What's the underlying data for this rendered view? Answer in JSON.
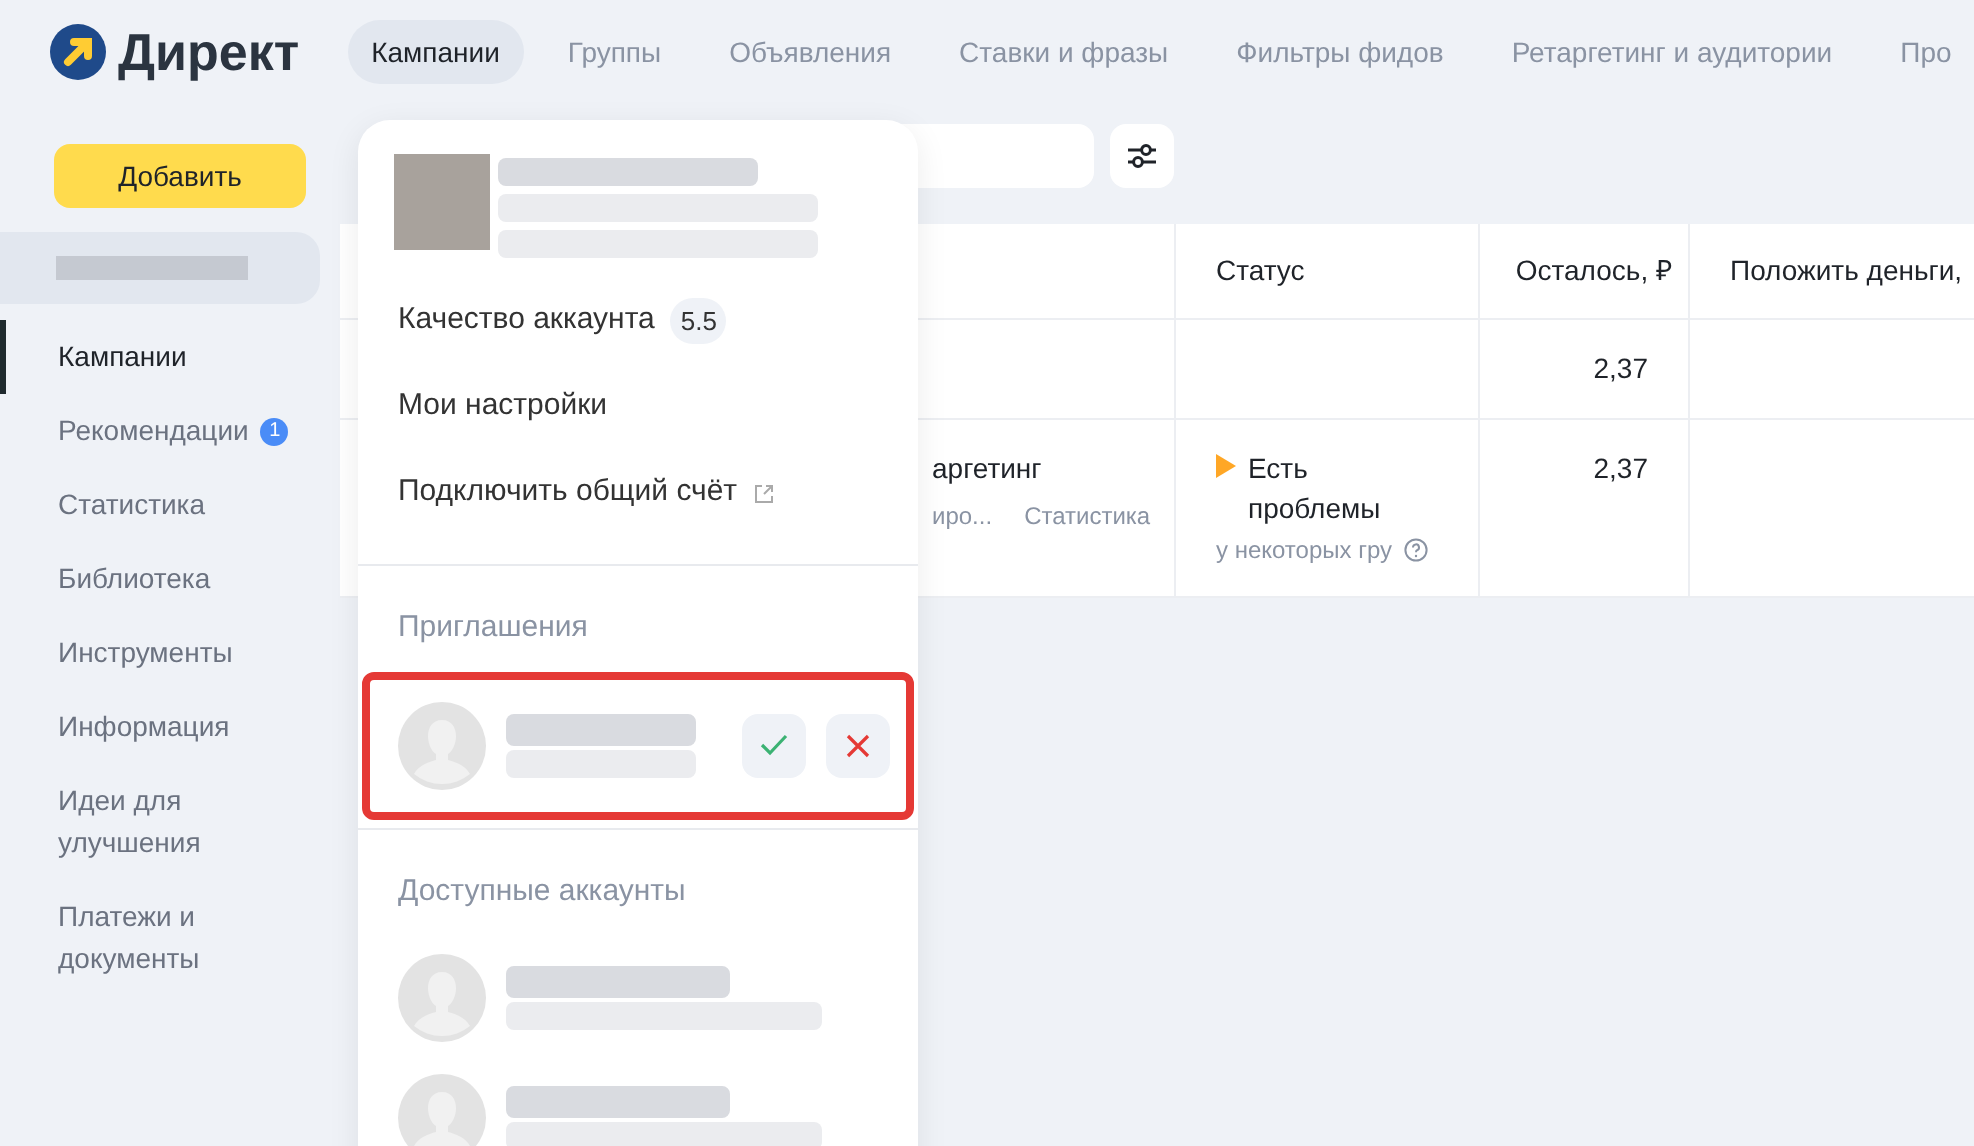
{
  "logo": {
    "text": "Директ"
  },
  "nav_tabs": [
    {
      "label": "Кампании",
      "selected": true
    },
    {
      "label": "Группы",
      "selected": false
    },
    {
      "label": "Объявления",
      "selected": false
    },
    {
      "label": "Ставки и фразы",
      "selected": false
    },
    {
      "label": "Фильтры фидов",
      "selected": false
    },
    {
      "label": "Ретаргетинг и аудитории",
      "selected": false
    },
    {
      "label": "Про",
      "selected": false
    }
  ],
  "sidebar": {
    "add_button": "Добавить",
    "items": [
      {
        "label": "Кампании",
        "selected": true
      },
      {
        "label": "Рекомендации",
        "selected": false,
        "badge": "1"
      },
      {
        "label": "Статистика",
        "selected": false
      },
      {
        "label": "Библиотека",
        "selected": false
      },
      {
        "label": "Инструменты",
        "selected": false
      },
      {
        "label": "Информация",
        "selected": false
      },
      {
        "label": "Идеи для улучшения",
        "selected": false
      },
      {
        "label": "Платежи и документы",
        "selected": false
      }
    ]
  },
  "table": {
    "columns": [
      "Статус",
      "Осталось, ₽",
      "Положить деньги,"
    ],
    "rows": [
      {
        "name": "",
        "name_sub": "",
        "name_link": "",
        "status": "",
        "status_sub": "",
        "remaining": "2,37"
      },
      {
        "name": "аргетинг",
        "name_sub": "иро...",
        "name_link": "Статистика",
        "status": "Есть проблемы",
        "status_sub": "у некоторых гру",
        "remaining": "2,37"
      }
    ]
  },
  "account_menu": {
    "items": [
      {
        "kind": "quality",
        "label": "Качество аккаунта",
        "badge": "5.5"
      },
      {
        "kind": "plain",
        "label": "Мои настройки"
      },
      {
        "kind": "external",
        "label": "Подключить общий счёт"
      }
    ],
    "invitations": {
      "title": "Приглашения",
      "items": [
        {
          "highlighted": true
        }
      ]
    },
    "accounts": {
      "title": "Доступные аккаунты"
    }
  }
}
